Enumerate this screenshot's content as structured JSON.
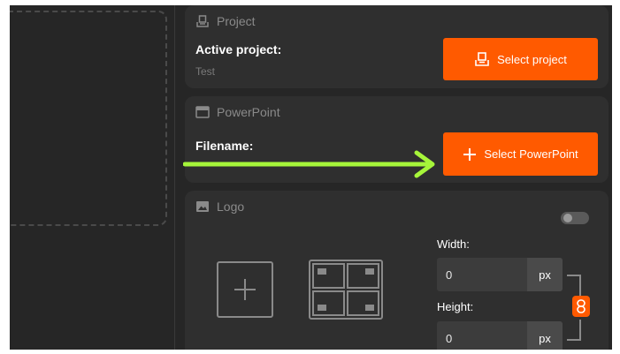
{
  "project": {
    "header": "Project",
    "active_label": "Active project:",
    "active_value": "Test",
    "select_button": "Select project"
  },
  "powerpoint": {
    "header": "PowerPoint",
    "filename_label": "Filename:",
    "select_button": "Select PowerPoint"
  },
  "logo": {
    "header": "Logo",
    "toggle_on": false,
    "width_label": "Width:",
    "width_value": "0",
    "width_unit": "px",
    "height_label": "Height:",
    "height_value": "0",
    "height_unit": "px"
  },
  "colors": {
    "accent": "#ff5a00",
    "annotation_arrow": "#a6f53a",
    "panel_bg": "#2f2f2f",
    "app_bg": "#262626"
  },
  "icons": [
    "project-icon",
    "select-project-icon",
    "powerpoint-icon",
    "plus-icon",
    "image-icon",
    "add-logo-icon",
    "position-grid-icon",
    "link-chain-icon"
  ]
}
